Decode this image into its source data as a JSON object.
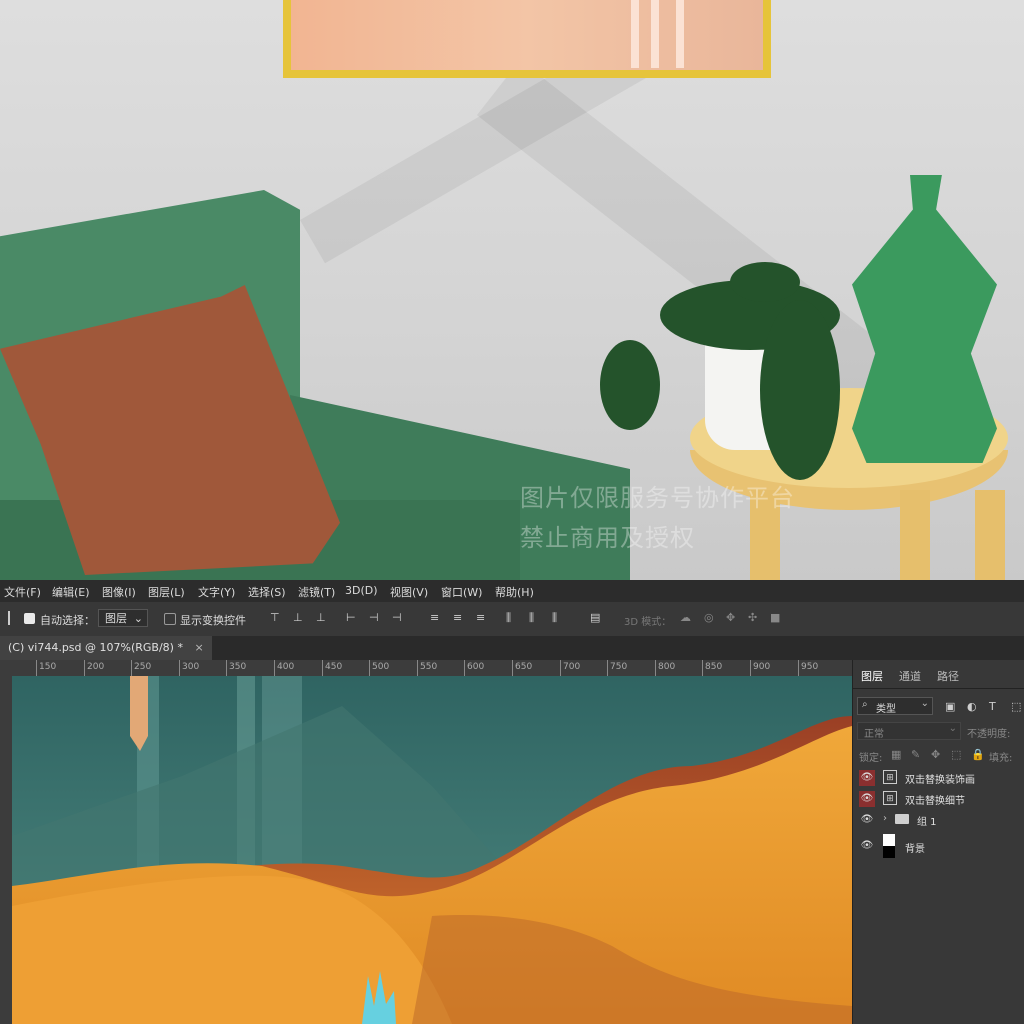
{
  "mockup": {
    "watermark_line1": "图片仅限服务号协作平台",
    "watermark_line2": "禁止商用及授权"
  },
  "menubar": {
    "items": [
      "文件(F)",
      "编辑(E)",
      "图像(I)",
      "图层(L)",
      "文字(Y)",
      "选择(S)",
      "滤镜(T)",
      "3D(D)",
      "视图(V)",
      "窗口(W)",
      "帮助(H)"
    ]
  },
  "options": {
    "auto_select_label": "自动选择：",
    "auto_select_value": "图层",
    "show_transform_label": "显示变换控件",
    "mode_3d_label": "3D 模式："
  },
  "document": {
    "tab_title": "(C) vi744.psd @ 107%(RGB/8) *",
    "close_glyph": "×"
  },
  "ruler": {
    "ticks": [
      "150",
      "200",
      "250",
      "300",
      "350",
      "400",
      "450",
      "500",
      "550",
      "600",
      "650",
      "700",
      "750",
      "800",
      "850",
      "900",
      "950"
    ]
  },
  "layers_panel": {
    "tabs": [
      "图层",
      "通道",
      "路径"
    ],
    "filter_kind": "类型",
    "blend_mode": "正常",
    "opacity_label": "不透明度:",
    "lock_label": "锁定:",
    "fill_label": "填充:",
    "layers": [
      {
        "name": "双击替换装饰画",
        "visible": true,
        "highlighted": true
      },
      {
        "name": "双击替换细节",
        "visible": true,
        "highlighted": true
      },
      {
        "name": "组 1",
        "visible": true,
        "highlighted": false
      },
      {
        "name": "背景",
        "visible": true,
        "highlighted": false
      }
    ]
  },
  "colors": {
    "frame": "#e6c43a",
    "sofa": "#4a8a66",
    "pillow": "#a0583a",
    "canvas_teal": "#3a6b66",
    "canvas_orange": "#e59a2b"
  }
}
